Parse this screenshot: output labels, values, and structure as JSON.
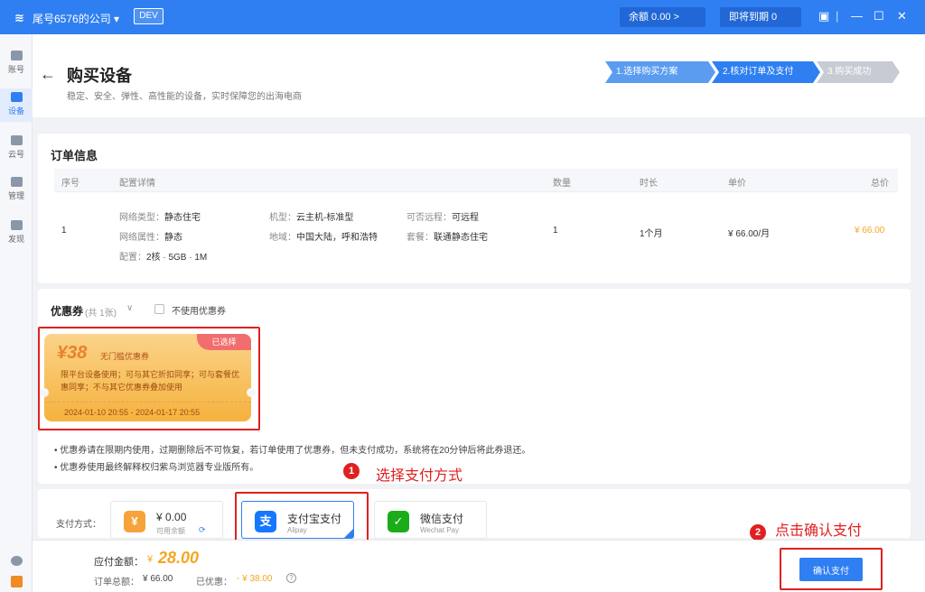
{
  "titlebar": {
    "company": "尾号6576的公司 ▾",
    "env_badge": "DEV",
    "balance": "余额 0.00 >",
    "expiring": "即将到期 0",
    "win_min": "—",
    "win_max": "☐",
    "win_close": "✕",
    "sep": "|"
  },
  "sidebar": {
    "items": [
      {
        "label": "账号",
        "icon": "account-icon"
      },
      {
        "label": "设备",
        "icon": "device-icon"
      },
      {
        "label": "云号",
        "icon": "cloud-icon"
      },
      {
        "label": "管理",
        "icon": "manage-icon"
      },
      {
        "label": "发现",
        "icon": "discover-icon"
      }
    ]
  },
  "header": {
    "back": "←",
    "title": "购买设备",
    "subtitle": "稳定、安全、弹性、高性能的设备，实时保障您的出海电商",
    "steps": [
      "1.选择购买方案",
      "2.核对订单及支付",
      "3.购买成功"
    ]
  },
  "order": {
    "title": "订单信息",
    "columns": [
      "序号",
      "配置详情",
      "数量",
      "时长",
      "单价",
      "总价"
    ],
    "row": {
      "index": "1",
      "net_type_label": "网络类型：",
      "net_type": "静态住宅",
      "model_label": "机型：",
      "model": "云主机-标准型",
      "remote_label": "可否远程：",
      "remote": "可远程",
      "net_attr_label": "网络属性：",
      "net_attr": "静态",
      "region_label": "地域：",
      "region": "中国大陆，呼和浩特",
      "plan_label": "套餐：",
      "plan": "联通静态住宅",
      "config_label": "配置：",
      "config": "2核 · 5GB · 1M",
      "qty": "1",
      "duration": "1个月",
      "unit_price": "¥ 66.00/月",
      "total": "¥ 66.00"
    }
  },
  "coupons": {
    "title": "优惠券",
    "count": "(共 1张)",
    "chevron": "∨",
    "no_coupon_label": "不使用优惠券",
    "coupon": {
      "amount": "¥38",
      "type": "无门槛优惠券",
      "selected": "已选择",
      "desc": "限平台设备使用；可与其它折扣同享；可与套餐优惠同享；不与其它优惠券叠加使用",
      "dates": "2024-01-10 20:55 - 2024-01-17 20:55"
    },
    "notes": [
      "• 优惠券请在限期内使用，过期删除后不可恢复，若订单使用了优惠券，但未支付成功，系统将在20分钟后将此券退还。",
      "• 优惠券使用最终解释权归紫鸟浏览器专业版所有。"
    ]
  },
  "annotations": {
    "step1_num": "1",
    "step1_text": "选择支付方式",
    "step2_num": "2",
    "step2_text": "点击确认支付"
  },
  "payment": {
    "label": "支付方式：",
    "balance": {
      "name": "¥ 0.00",
      "sub": "可用余额",
      "glyph": "¥"
    },
    "alipay": {
      "name": "支付宝支付",
      "sub": "Alipay",
      "glyph": "支"
    },
    "wechat": {
      "name": "微信支付",
      "sub": "Wechat Pay",
      "glyph": "✓"
    }
  },
  "footer": {
    "payable_label": "应付金额：",
    "payable_currency": "¥",
    "payable": "28.00",
    "total_label": "订单总额：",
    "total": "¥ 66.00",
    "discount_label": "已优惠：",
    "discount": "- ¥ 38.00",
    "help": "?",
    "confirm": "确认支付"
  }
}
